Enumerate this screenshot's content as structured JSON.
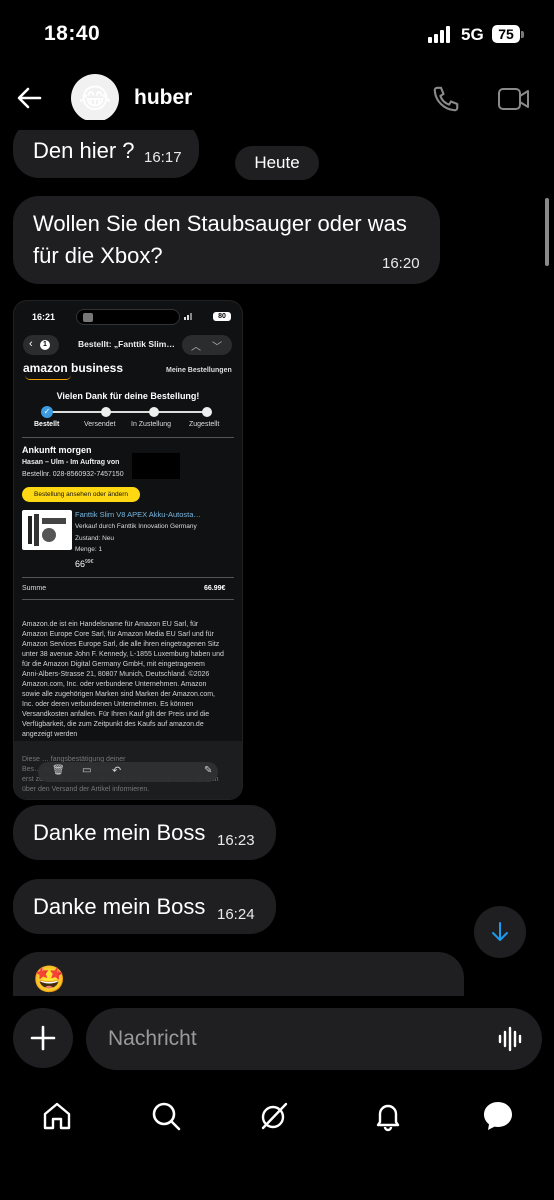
{
  "status": {
    "time": "18:40",
    "network": "5G",
    "battery": "75"
  },
  "header": {
    "contact_name": "huber",
    "avatar_emoji": "😂"
  },
  "date_separator": "Heute",
  "messages": [
    {
      "text": "Den hier ?",
      "time": "16:17"
    },
    {
      "text_line1": "Wollen Sie den Staubsauger oder was",
      "text_line2": "für die Xbox?",
      "time": "16:20"
    },
    {
      "text": "Danke mein Boss",
      "time": "16:23"
    },
    {
      "text": "Danke mein Boss",
      "time": "16:24"
    },
    {
      "emoji": "🤩"
    }
  ],
  "shared_screenshot": {
    "time": "16:21",
    "battery": "80",
    "nav_badge": "1",
    "nav_title": "Bestellt: „Fanttik Slim…",
    "brand": "amazon business",
    "my_orders": "Meine Bestellungen",
    "thanks": "Vielen Dank für deine Bestellung!",
    "steps": [
      "Bestellt",
      "Versendet",
      "In Zustellung",
      "Zugestellt"
    ],
    "progress_step": 1,
    "arrival": "Ankunft morgen",
    "recipient": "Hasan – Ulm - Im Auftrag von",
    "order_no": "Bestellnr. 028-8560932-7457150",
    "view_button": "Bestellung ansehen oder ändern",
    "product_title": "Fanttik Slim V8 APEX Akku-Autosta…",
    "seller": "Verkauf durch Fanttik Innovation Germany",
    "condition": "Zustand: Neu",
    "quantity": "Menge: 1",
    "price_main": "66",
    "price_cents": "99€",
    "sum_label": "Summe",
    "sum_value": "66.99€",
    "legal_lines": [
      "Amazon.de ist ein Handelsname für Amazon EU Sarl, für",
      "Amazon Europe Core Sarl, für Amazon Media EU Sarl und für",
      "Amazon Services Europe Sarl, die alle ihren eingetragenen Sitz",
      "unter 38 avenue John F. Kennedy, L-1855 Luxemburg haben und",
      "für die Amazon Digital Germany GmbH, mit eingetragenem",
      "Anni-Albers-Strasse 21, 80807 Munich, Deutschland. ©2026",
      "Amazon.com, Inc. oder verbundene Unternehmen. Amazon",
      "sowie alle zugehörigen Marken sind Marken der Amazon.com,",
      "Inc. oder deren verbundenen Unternehmen. Es können",
      "Versandkosten anfallen. Für Ihren Kauf gilt der Preis und die",
      "Verfügbarkeit, die zum Zeitpunkt des Kaufs auf amazon.de",
      "angezeigt werden"
    ],
    "footer_lines": [
      "Diese … fangsbestätigung deiner",
      "Bes… den Kauf dieser Artikel",
      "erst zustande, wenn wir dir eine E-Mail schicken, in der wir dich",
      "über den Versand der Artikel informieren."
    ]
  },
  "composer": {
    "placeholder": "Nachricht"
  },
  "colors": {
    "background": "#000000",
    "bubble": "#1f1f21",
    "accent_blue": "#1d9bf0",
    "amazon_yellow": "#ffd814",
    "link": "#79b7e0"
  }
}
